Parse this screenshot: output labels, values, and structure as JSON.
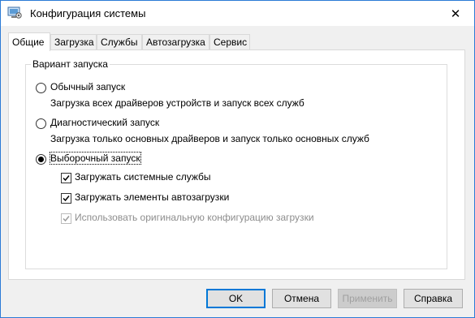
{
  "window": {
    "title": "Конфигурация системы",
    "close_glyph": "✕"
  },
  "tabs": [
    {
      "label": "Общие",
      "active": true
    },
    {
      "label": "Загрузка",
      "active": false
    },
    {
      "label": "Службы",
      "active": false
    },
    {
      "label": "Автозагрузка",
      "active": false
    },
    {
      "label": "Сервис",
      "active": false
    }
  ],
  "startup": {
    "group_label": "Вариант запуска",
    "normal": {
      "label": "Обычный запуск",
      "description": "Загрузка всех драйверов устройств и запуск всех служб",
      "checked": false
    },
    "diagnostic": {
      "label": "Диагностический запуск",
      "description": "Загрузка только основных драйверов и запуск только основных служб",
      "checked": false
    },
    "selective": {
      "label": "Выборочный запуск",
      "checked": true,
      "options": [
        {
          "label": "Загружать системные службы",
          "checked": true,
          "enabled": true
        },
        {
          "label": "Загружать элементы автозагрузки",
          "checked": true,
          "enabled": true
        },
        {
          "label": "Использовать оригинальную конфигурацию загрузки",
          "checked": true,
          "enabled": false
        }
      ]
    }
  },
  "buttons": {
    "ok": "OK",
    "cancel": "Отмена",
    "apply": "Применить",
    "help": "Справка"
  },
  "colors": {
    "window_border": "#2b7bd6",
    "default_button_border": "#0078d7",
    "disabled_text": "#8d8d8d"
  },
  "icons": {
    "app": "system-config-icon",
    "close": "close-icon",
    "check": "checkmark-icon"
  }
}
